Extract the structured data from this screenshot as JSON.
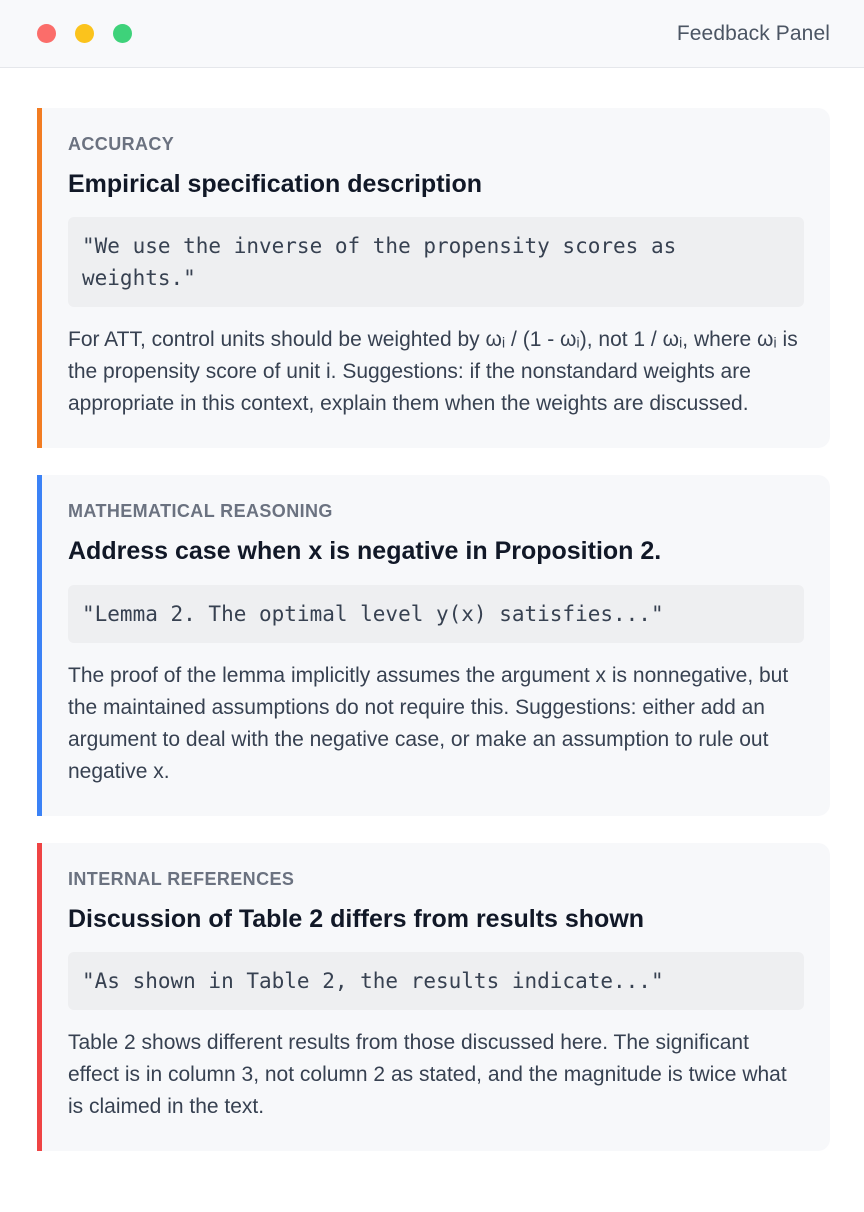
{
  "window": {
    "title": "Feedback Panel"
  },
  "cards": [
    {
      "category": "ACCURACY",
      "heading": "Empirical specification description",
      "quote": "\"We use the inverse of the propensity scores as weights.\"",
      "body": "For ATT, control units should be weighted by ωᵢ / (1 - ωᵢ), not 1 / ωᵢ, where ωᵢ is the propensity score of unit i. Suggestions: if the nonstandard weights are appropriate in this context, explain them when the weights are discussed.",
      "accent": "#f27c22"
    },
    {
      "category": "MATHEMATICAL REASONING",
      "heading": "Address case when x is negative in Proposition 2.",
      "quote": "\"Lemma 2. The optimal level y(x) satisfies...\"",
      "body": "The proof of the lemma implicitly assumes the argument x is nonnegative, but the maintained assumptions do not require this. Suggestions: either add an argument to deal with the negative case, or make an assumption to rule out negative x.",
      "accent": "#3b82f6"
    },
    {
      "category": "INTERNAL REFERENCES",
      "heading": "Discussion of Table 2 differs from results shown",
      "quote": "\"As shown in Table 2, the results indicate...\"",
      "body": "Table 2 shows different results from those discussed here. The significant effect is in column 3, not column 2 as stated, and the magnitude is twice what is claimed in the text.",
      "accent": "#ef4444"
    }
  ]
}
